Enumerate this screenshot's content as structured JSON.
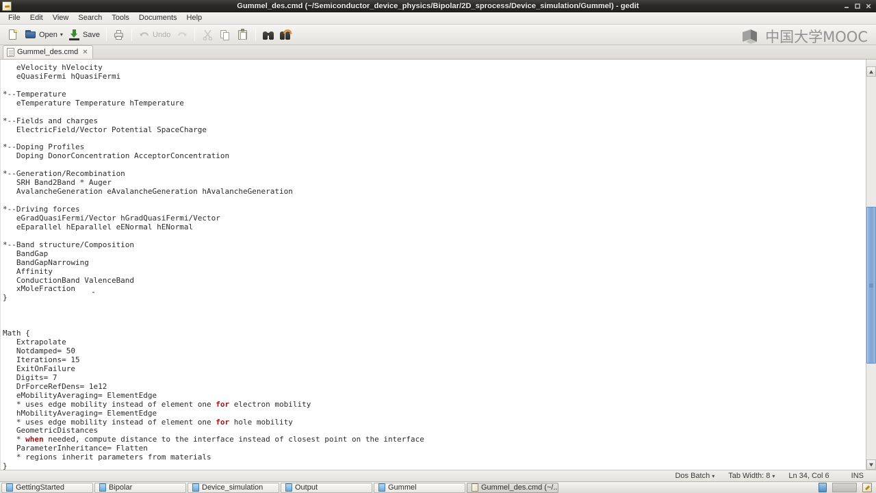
{
  "window": {
    "title": "Gummel_des.cmd (~/Semiconductor_device_physics/Bipolar/2D_sprocess/Device_simulation/Gummel) - gedit",
    "app_icon": "gedit-icon",
    "controls": {
      "minimize": "minimize-icon",
      "maximize": "maximize-icon",
      "close": "close-icon"
    }
  },
  "menubar": {
    "items": [
      {
        "label": "File"
      },
      {
        "label": "Edit"
      },
      {
        "label": "View"
      },
      {
        "label": "Search"
      },
      {
        "label": "Tools"
      },
      {
        "label": "Documents"
      },
      {
        "label": "Help"
      }
    ]
  },
  "toolbar": {
    "new_label": "",
    "open_label": "Open",
    "save_label": "Save",
    "print_label": "",
    "undo_label": "Undo",
    "redo_label": "",
    "cut_label": "",
    "copy_label": "",
    "paste_label": "",
    "find_label": "",
    "replace_label": "",
    "dropdown_glyph": "▾"
  },
  "watermark": {
    "text": "中国大学MOOC",
    "color": "#8b8b8b"
  },
  "tabs": [
    {
      "label": "Gummel_des.cmd",
      "close_glyph": "✕",
      "active": true
    }
  ],
  "editor": {
    "language_keywords": [
      "for",
      "when"
    ],
    "keyword_color": "#9b1313",
    "text_color": "#2b2b2b",
    "background": "#ffffff",
    "lines": [
      "   eVelocity hVelocity",
      "   eQuasiFermi hQuasiFermi",
      "",
      "*--Temperature",
      "   eTemperature Temperature hTemperature",
      "",
      "*--Fields and charges",
      "   ElectricField/Vector Potential SpaceCharge",
      "",
      "*--Doping Profiles",
      "   Doping DonorConcentration AcceptorConcentration",
      "",
      "*--Generation/Recombination",
      "   SRH Band2Band * Auger",
      "   AvalancheGeneration eAvalancheGeneration hAvalancheGeneration",
      "",
      "*--Driving forces",
      "   eGradQuasiFermi/Vector hGradQuasiFermi/Vector",
      "   eEparallel hEparallel eENormal hENormal",
      "",
      "*--Band structure/Composition",
      "   BandGap",
      "   BandGapNarrowing",
      "   Affinity",
      "   ConductionBand ValenceBand",
      "   xMoleFraction",
      "}",
      "",
      "",
      "",
      "Math {",
      "   Extrapolate",
      "   Notdamped= 50",
      "   Iterations= 15",
      "   ExitOnFailure",
      "   Digits= 7",
      "   DrForceRefDens= 1e12",
      "   eMobilityAveraging= ElementEdge",
      "   * uses edge mobility instead of element one @@for@@ electron mobility",
      "   hMobilityAveraging= ElementEdge",
      "   * uses edge mobility instead of element one @@for@@ hole mobility",
      "   GeometricDistances",
      "   * @@when@@ needed, compute distance to the interface instead of closest point on the interface",
      "   ParameterInheritance= Flatten",
      "   * regions inherit parameters from materials",
      "}"
    ]
  },
  "scrollbar": {
    "orientation": "vertical",
    "thumb_top_percent": 34,
    "thumb_height_percent": 41,
    "thumb_color": "#8fb0d7"
  },
  "statusbar": {
    "language": "Dos Batch",
    "language_chevron": "▾",
    "tab_width_label": "Tab Width:",
    "tab_width_value": "8",
    "tab_width_chevron": "▾",
    "cursor_position": "Ln 34, Col 6",
    "insert_mode": "INS"
  },
  "taskbar": {
    "items": [
      {
        "label": "GettingStarted",
        "icon": "folder-icon",
        "active": false
      },
      {
        "label": "Bipolar",
        "icon": "folder-icon",
        "active": false
      },
      {
        "label": "Device_simulation",
        "icon": "folder-icon",
        "active": false
      },
      {
        "label": "Output",
        "icon": "folder-icon",
        "active": false
      },
      {
        "label": "Gummel",
        "icon": "folder-icon",
        "active": false
      },
      {
        "label": "Gummel_des.cmd (~/...",
        "icon": "gedit-icon",
        "active": true
      }
    ]
  }
}
